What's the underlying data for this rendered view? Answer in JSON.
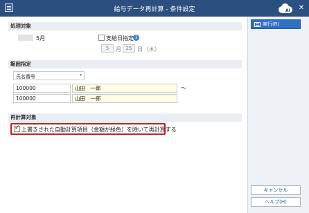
{
  "window": {
    "title": "給与データ再計算 - 条件設定",
    "close_glyph": "✕"
  },
  "sections": {
    "target": {
      "header": "処理対象",
      "month": "5月",
      "payday_checkbox_label": "支給日指定",
      "payday_checked": false,
      "info_glyph": "i",
      "date_month": "5",
      "date_month_unit": "月",
      "date_day": "25",
      "date_day_unit": "日",
      "date_weekday": "（木）"
    },
    "range": {
      "header": "範囲指定",
      "dropdown_value": "氏名番号",
      "dropdown_arrow": "▾",
      "from_code": "100000",
      "from_name": "山田　一郎",
      "to_code": "100000",
      "to_name": "山田　一郎",
      "tilde": "～"
    },
    "recalc": {
      "header": "再計算対象",
      "exclude_label": "上書きされた自動計算項目（金額が緑色）を除いて再計算する",
      "exclude_checked": true
    }
  },
  "buttons": {
    "execute": "実行(R)",
    "cancel": "キャンセル",
    "help": "ヘルプ(H)"
  },
  "colors": {
    "titlebar": "#2b4f7e",
    "primary": "#2f6fc4",
    "highlight": "#d7191c"
  },
  "icons": {
    "app": "app-icon",
    "cloud": "cloud-ai-icon",
    "info": "info-icon",
    "execute": "execute-icon"
  }
}
